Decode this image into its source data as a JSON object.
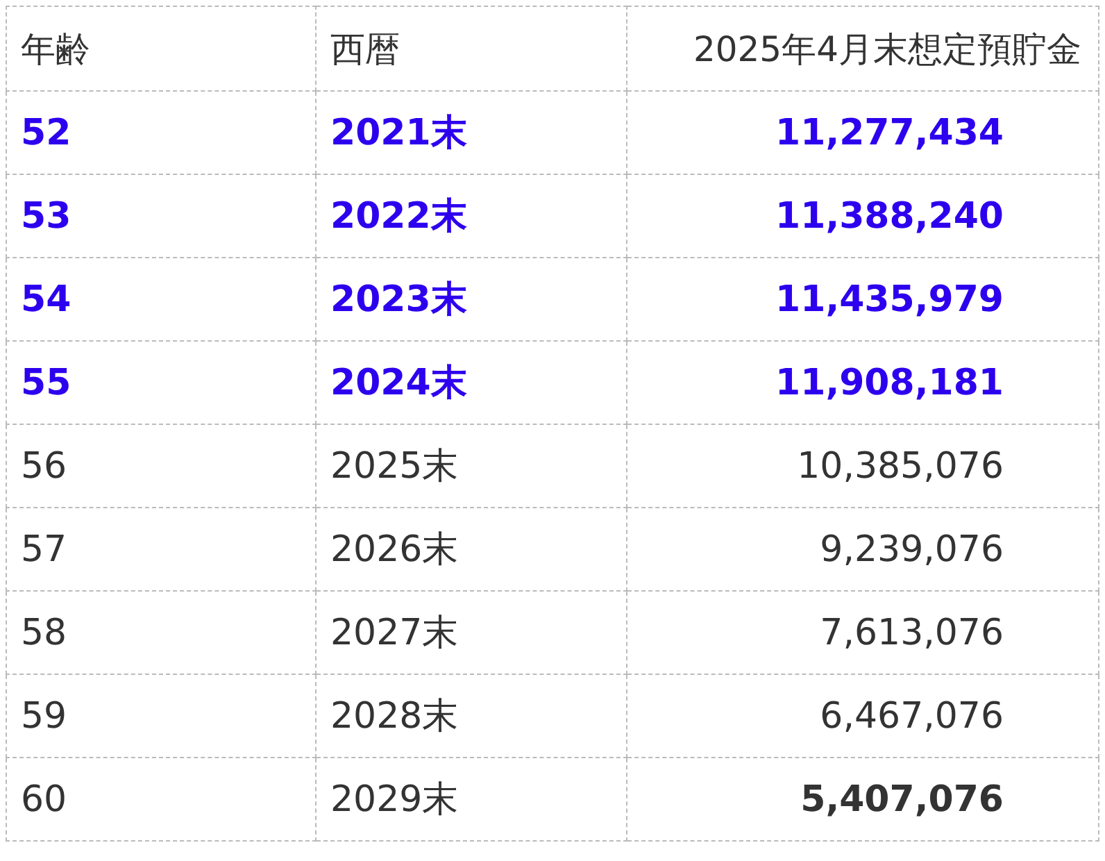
{
  "table": {
    "columns": [
      "年齢",
      "西暦",
      "2025年4月末想定預貯金"
    ],
    "rows": [
      {
        "kind": "past",
        "cells": [
          "52",
          "2021末",
          "11,277,434"
        ]
      },
      {
        "kind": "past",
        "cells": [
          "53",
          "2022末",
          "11,388,240"
        ]
      },
      {
        "kind": "past",
        "cells": [
          "54",
          "2023末",
          "11,435,979"
        ]
      },
      {
        "kind": "past",
        "cells": [
          "55",
          "2024末",
          "11,908,181"
        ]
      },
      {
        "kind": "plan",
        "cells": [
          "56",
          "2025末",
          "10,385,076"
        ]
      },
      {
        "kind": "plan",
        "cells": [
          "57",
          "2026末",
          "9,239,076"
        ]
      },
      {
        "kind": "plan",
        "cells": [
          "58",
          "2027末",
          "7,613,076"
        ]
      },
      {
        "kind": "plan",
        "cells": [
          "59",
          "2028末",
          "6,467,076"
        ]
      },
      {
        "kind": "final",
        "cells": [
          "60",
          "2029末",
          "5,407,076"
        ]
      }
    ]
  }
}
